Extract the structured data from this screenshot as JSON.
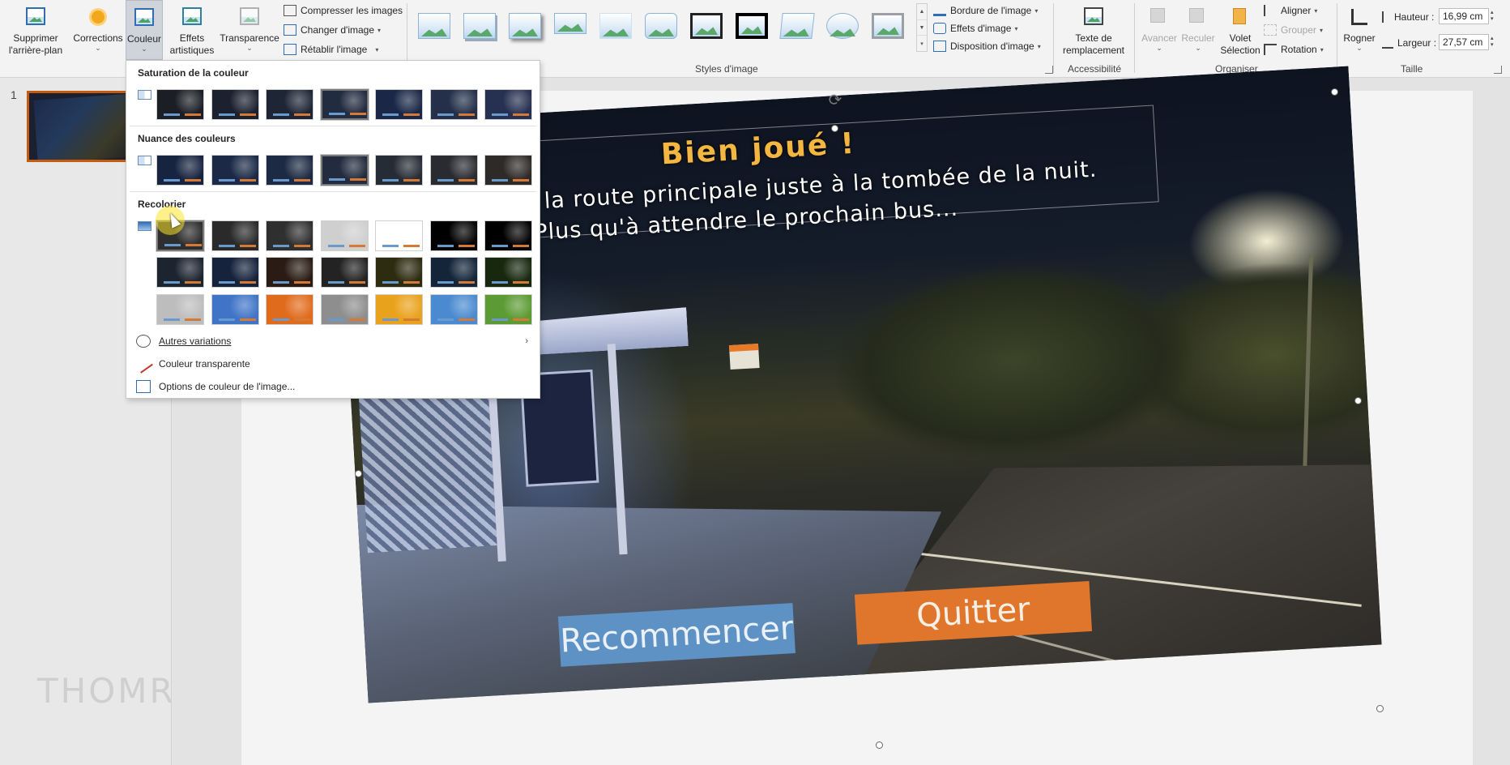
{
  "ribbon": {
    "remove_bg": {
      "line1": "Supprimer",
      "line2": "l'arrière-plan"
    },
    "corrections": "Corrections",
    "color": "Couleur",
    "artistic": {
      "line1": "Effets",
      "line2": "artistiques"
    },
    "transparency": "Transparence",
    "compress": "Compresser les images",
    "change": "Changer d'image",
    "reset": "Rétablir l'image",
    "styles_group": "Styles d'image",
    "border": "Bordure de l'image",
    "effects": "Effets d'image",
    "layout": "Disposition d'image",
    "alt_text": {
      "line1": "Texte de",
      "line2": "remplacement"
    },
    "accessibility_group": "Accessibilité",
    "forward": "Avancer",
    "backward": "Reculer",
    "selection_pane": {
      "line1": "Volet",
      "line2": "Sélection"
    },
    "align": "Aligner",
    "group": "Grouper",
    "rotate": "Rotation",
    "arrange_group": "Organiser",
    "crop": "Rogner",
    "height_label": "Hauteur :",
    "height_value": "16,99 cm",
    "width_label": "Largeur :",
    "width_value": "27,57 cm",
    "size_group": "Taille"
  },
  "thumbnails": {
    "slide_number": "1"
  },
  "watermark": "THOMRES",
  "slide": {
    "title": "Bien joué !",
    "line1": "...ouve la route principale juste à la tombée de la nuit.",
    "line2": "Plus qu'à attendre le prochain bus...",
    "restart_button": "Recommencer",
    "quit_button": "Quitter"
  },
  "color_menu": {
    "saturation_heading": "Saturation de la couleur",
    "tone_heading": "Nuance des couleurs",
    "recolor_heading": "Recolorier",
    "more_variations": "Autres variations",
    "transparent_color": "Couleur transparente",
    "color_options": "Options de couleur de l'image..."
  },
  "swatches": {
    "saturation": [
      "#1b1e24",
      "#1c2130",
      "#1e2636",
      "#222c40",
      "#1a2746",
      "#24304a",
      "#263050"
    ],
    "tone": [
      "#172440",
      "#1b2946",
      "#1d2a44",
      "#232c3e",
      "#262c36",
      "#2a2b30",
      "#2e2a28"
    ],
    "recolor_row1": [
      "#2e2e2e",
      "#2a2a2a",
      "#2f2f2f",
      "#cfcfcf",
      "#ffffff",
      "#000000",
      "#000000"
    ],
    "recolor_row2": [
      "#1c2430",
      "#16233c",
      "#2a1c14",
      "#232323",
      "#2e2c10",
      "#14253a",
      "#17280f"
    ],
    "recolor_row3": [
      "#bdbdbd",
      "#3f74c7",
      "#e06b1c",
      "#8e8e8e",
      "#e9a21b",
      "#4a8ad0",
      "#5c9a33"
    ]
  },
  "colors": {
    "accent_orange": "#c55a11",
    "ribbon_bg": "#f3f3f3"
  }
}
